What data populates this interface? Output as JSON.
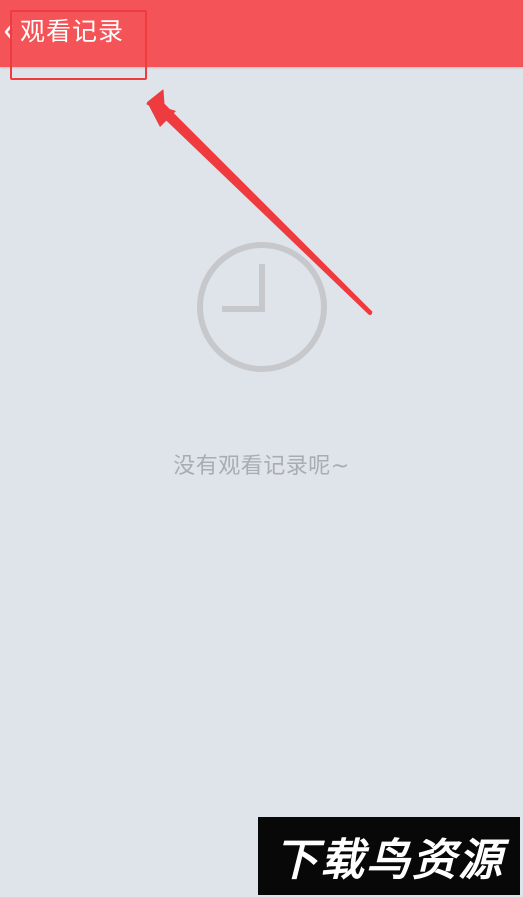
{
  "header": {
    "back_icon": "chevron-left-icon",
    "title": "观看记录"
  },
  "empty_state": {
    "icon": "clock-icon",
    "message": "没有观看记录呢~"
  },
  "watermark": {
    "text": "下载鸟资源"
  },
  "colors": {
    "header_background": "#f45457",
    "page_background": "#dfe3ea",
    "annotation_red": "#ee3b3f",
    "empty_icon": "#c6c8cc",
    "empty_text": "#a9acb2"
  }
}
